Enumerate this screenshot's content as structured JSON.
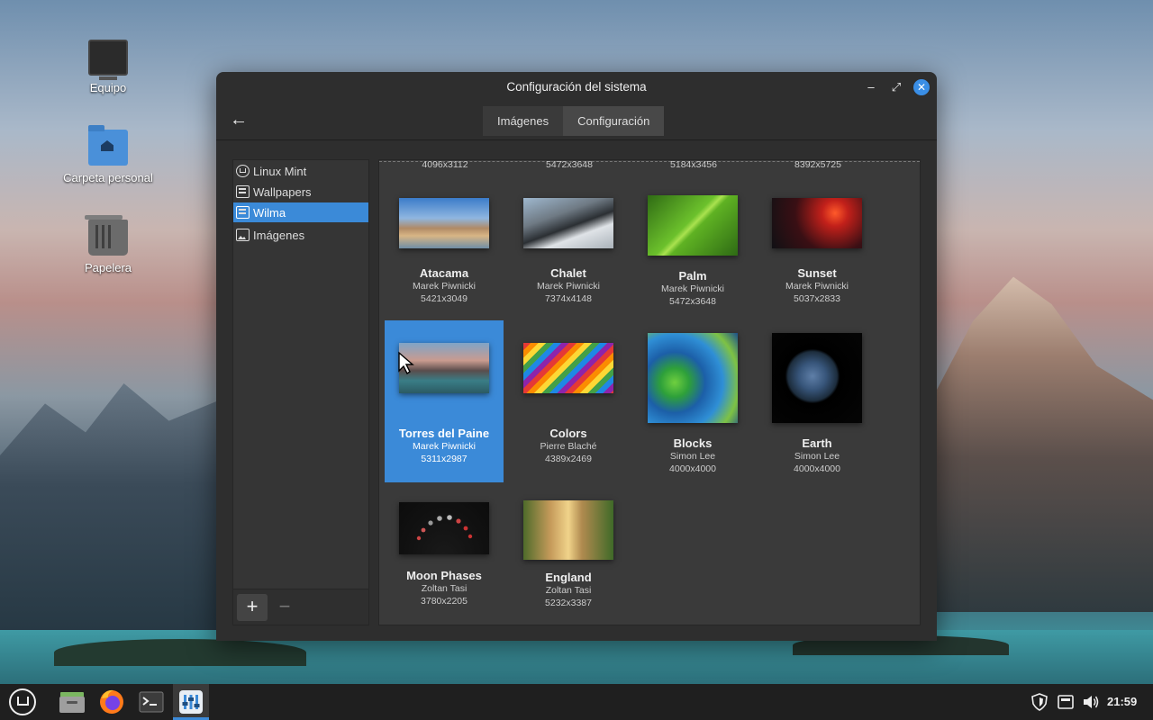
{
  "desktop": {
    "icons": [
      {
        "label": "Equipo"
      },
      {
        "label": "Carpeta personal"
      },
      {
        "label": "Papelera"
      }
    ]
  },
  "window": {
    "title": "Configuración del sistema",
    "controls": {
      "minimize": "–",
      "maximize": "⤢",
      "close": "✕"
    },
    "back_glyph": "←",
    "tabs": [
      {
        "label": "Imágenes",
        "active": false
      },
      {
        "label": "Configuración",
        "active": true
      }
    ]
  },
  "sidebar": {
    "items": [
      {
        "label": "Linux Mint",
        "icon": "linux-mint-icon"
      },
      {
        "label": "Wallpapers",
        "icon": "wallpapers-icon"
      },
      {
        "label": "Wilma",
        "icon": "wallpapers-icon",
        "selected": true
      },
      {
        "label": "Imágenes",
        "icon": "image-icon"
      }
    ],
    "add_label": "+",
    "remove_label": "−"
  },
  "gallery": {
    "top_row_sizes": [
      "4096x3112",
      "5472x3648",
      "5184x3456",
      "8392x5725"
    ],
    "items": [
      {
        "name": "Atacama",
        "author": "Marek Piwnicki",
        "size": "5421x3049",
        "selected": false
      },
      {
        "name": "Chalet",
        "author": "Marek Piwnicki",
        "size": "7374x4148",
        "selected": false
      },
      {
        "name": "Palm",
        "author": "Marek Piwnicki",
        "size": "5472x3648",
        "selected": false
      },
      {
        "name": "Sunset",
        "author": "Marek Piwnicki",
        "size": "5037x2833",
        "selected": false
      },
      {
        "name": "Torres del Paine",
        "author": "Marek Piwnicki",
        "size": "5311x2987",
        "selected": true
      },
      {
        "name": "Colors",
        "author": "Pierre Blaché",
        "size": "4389x2469",
        "selected": false
      },
      {
        "name": "Blocks",
        "author": "Simon Lee",
        "size": "4000x4000",
        "selected": false
      },
      {
        "name": "Earth",
        "author": "Simon Lee",
        "size": "4000x4000",
        "selected": false
      },
      {
        "name": "Moon Phases",
        "author": "Zoltan Tasi",
        "size": "3780x2205",
        "selected": false
      },
      {
        "name": "England",
        "author": "Zoltan Tasi",
        "size": "5232x3387",
        "selected": false
      }
    ]
  },
  "taskbar": {
    "clock": "21:59",
    "apps": [
      "menu",
      "files",
      "firefox",
      "terminal",
      "system-settings"
    ]
  },
  "colors": {
    "accent": "#3b8ad8",
    "window_bg": "#2e2e2e",
    "panel_bg": "#1f1f1f"
  }
}
